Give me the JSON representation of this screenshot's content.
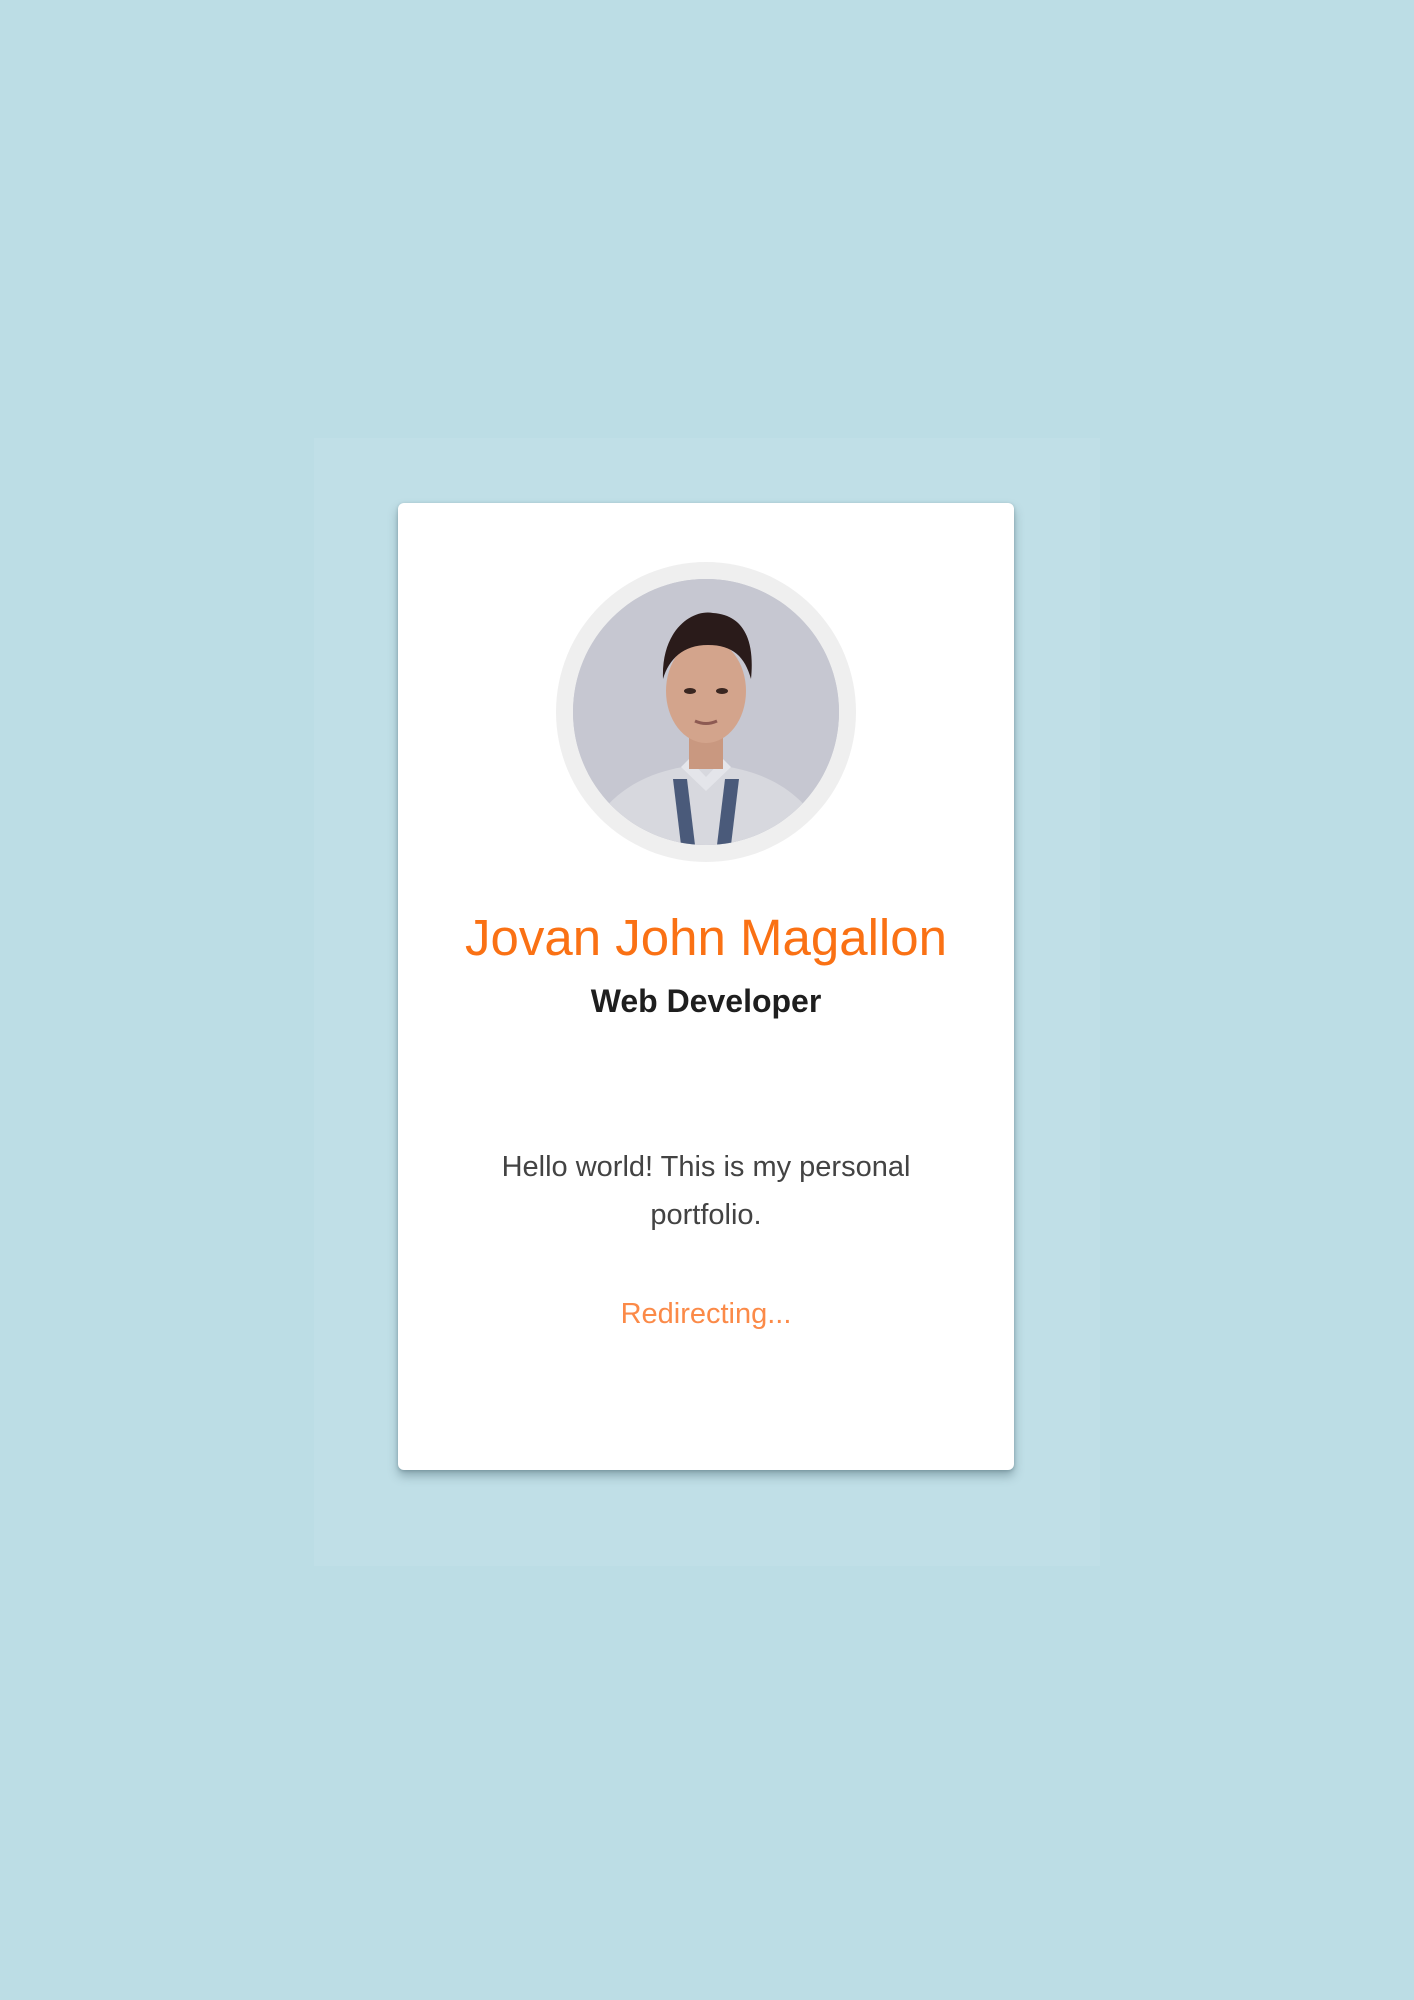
{
  "profile": {
    "name": "Jovan John Magallon",
    "role": "Web Developer",
    "bio": "Hello world! This is my personal portfolio.",
    "status": "Redirecting..."
  },
  "colors": {
    "background": "#bcdde5",
    "card": "#ffffff",
    "accent": "#fa7114",
    "status": "#fb8a48",
    "text": "#434343",
    "heading": "#1e1e1e"
  },
  "icons": {
    "avatar": "profile-photo"
  }
}
